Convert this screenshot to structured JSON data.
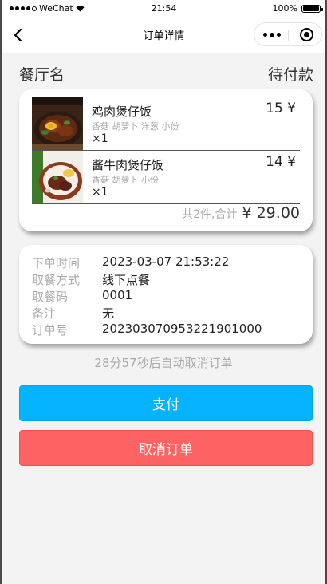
{
  "status_bar": {
    "carrier": "WeChat",
    "time": "21:54",
    "battery": "100%"
  },
  "nav": {
    "title": "订单详情"
  },
  "order": {
    "restaurant_name": "餐厅名",
    "status": "待付款"
  },
  "items": [
    {
      "name": "鸡肉煲仔饭",
      "desc": "香菇 胡萝卜 洋葱 小份",
      "qty": "×1",
      "price": "15 ¥"
    },
    {
      "name": "酱牛肉煲仔饭",
      "desc": "香菇 胡萝卜 小份",
      "qty": "×1",
      "price": "14 ¥"
    }
  ],
  "summary": {
    "count_text": "共2件,合计",
    "total": "¥ 29.00"
  },
  "info": [
    {
      "label": "下单时间",
      "value": "2023-03-07 21:53:22"
    },
    {
      "label": "取餐方式",
      "value": "线下点餐"
    },
    {
      "label": "取餐码",
      "value": "0001"
    },
    {
      "label": "备注",
      "value": "无"
    },
    {
      "label": "订单号",
      "value": "20230307095322190100​0"
    }
  ],
  "countdown": "28分57秒后自动取消订单",
  "buttons": {
    "pay": "支付",
    "cancel": "取消订单"
  },
  "colors": {
    "pay": "#06b3ff",
    "cancel": "#fe6363",
    "background": "#f3f3f3"
  }
}
